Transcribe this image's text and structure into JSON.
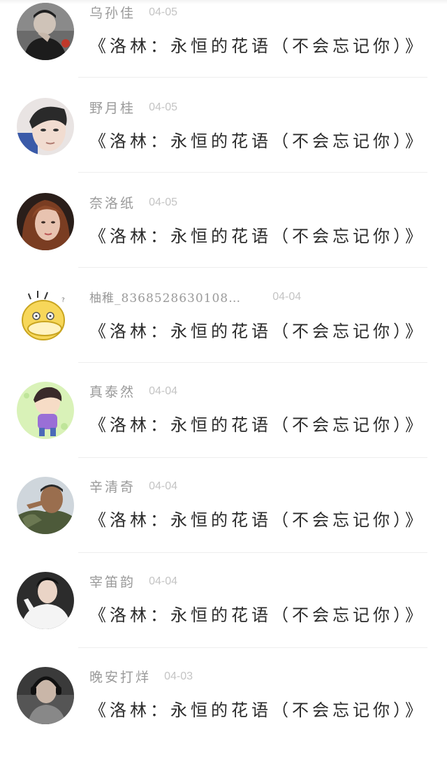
{
  "comments": [
    {
      "name": "乌孙佳",
      "date": "04-05",
      "text": "《洛林：永恒的花语（不会忘记你）》",
      "avatar": "avatar-man-dark-jacket-icon"
    },
    {
      "name": "野月桂",
      "date": "04-05",
      "text": "《洛林：永恒的花语（不会忘记你）》",
      "avatar": "avatar-young-man-face-icon"
    },
    {
      "name": "奈洛纸",
      "date": "04-05",
      "text": "《洛林：永恒的花语（不会忘记你）》",
      "avatar": "avatar-woman-auburn-hair-icon"
    },
    {
      "name": "柚稚_8368528630108…",
      "date": "04-04",
      "text": "《洛林：永恒的花语（不会忘记你）》",
      "avatar": "avatar-yellow-duck-cartoon-icon"
    },
    {
      "name": "真泰然",
      "date": "04-04",
      "text": "《洛林：永恒的花语（不会忘记你）》",
      "avatar": "avatar-cartoon-boy-icon"
    },
    {
      "name": "辛清奇",
      "date": "04-04",
      "text": "《洛林：永恒的花语（不会忘记你）》",
      "avatar": "avatar-soldier-salute-icon"
    },
    {
      "name": "宰笛韵",
      "date": "04-04",
      "text": "《洛林：永恒的花语（不会忘记你）》",
      "avatar": "avatar-person-white-shirt-icon"
    },
    {
      "name": "晚安打烊",
      "date": "04-03",
      "text": "《洛林：永恒的花语（不会忘记你）》",
      "avatar": "avatar-person-headphones-icon"
    }
  ]
}
